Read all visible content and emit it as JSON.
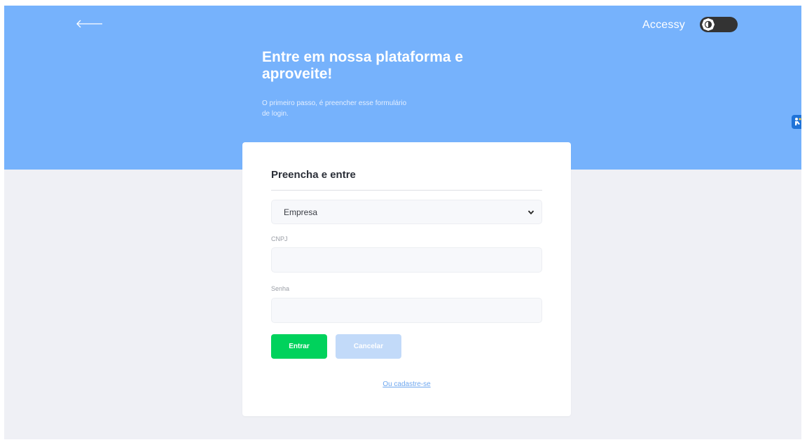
{
  "header": {
    "accessy_label": "Accessy"
  },
  "hero": {
    "title": "Entre em nossa plataforma e aproveite!",
    "subtitle": "O primeiro passo, é preencher esse formulário de login."
  },
  "form": {
    "title": "Preencha e entre",
    "type_select": {
      "selected": "Empresa"
    },
    "cnpj_label": "CNPJ",
    "cnpj_value": "",
    "password_label": "Senha",
    "password_value": "",
    "submit_label": "Entrar",
    "cancel_label": "Cancelar",
    "signup_link": "Ou cadastre-se"
  },
  "icons": {
    "back": "arrow-left-icon",
    "contrast": "contrast-icon",
    "accessibility": "accessibility-hand-icon",
    "chevron": "chevron-down-icon"
  },
  "colors": {
    "hero_background": "#76b2fc",
    "page_background": "#eff0f5",
    "primary_button": "#00d25c",
    "secondary_button": "#c2daf9",
    "link": "#6ea7ef",
    "toggle": "#333333"
  }
}
